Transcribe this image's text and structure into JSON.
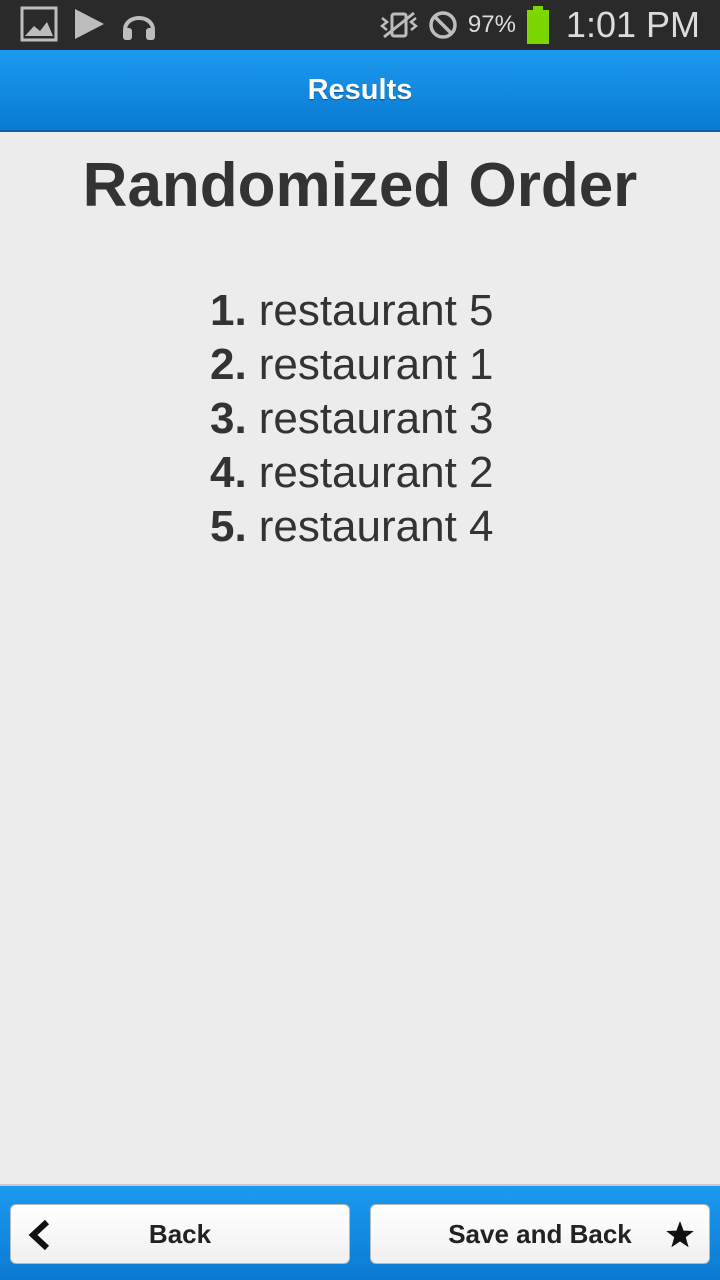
{
  "status_bar": {
    "battery": "97%",
    "time": "1:01 PM",
    "icons": [
      "gallery-icon",
      "play-icon",
      "headphones-icon",
      "vibrate-icon",
      "blocked-icon",
      "battery-icon"
    ],
    "battery_color": "#7ed600"
  },
  "action_bar": {
    "title": "Results",
    "color": "#1a8ee6"
  },
  "main": {
    "heading": "Randomized Order",
    "items": [
      {
        "number": "1.",
        "label": "restaurant 5"
      },
      {
        "number": "2.",
        "label": "restaurant 1"
      },
      {
        "number": "3.",
        "label": "restaurant 3"
      },
      {
        "number": "4.",
        "label": "restaurant 2"
      },
      {
        "number": "5.",
        "label": "restaurant 4"
      }
    ]
  },
  "bottom_bar": {
    "back_label": "Back",
    "back_icon": "chevron-left-icon",
    "save_label": "Save and Back",
    "save_icon": "star-icon"
  }
}
